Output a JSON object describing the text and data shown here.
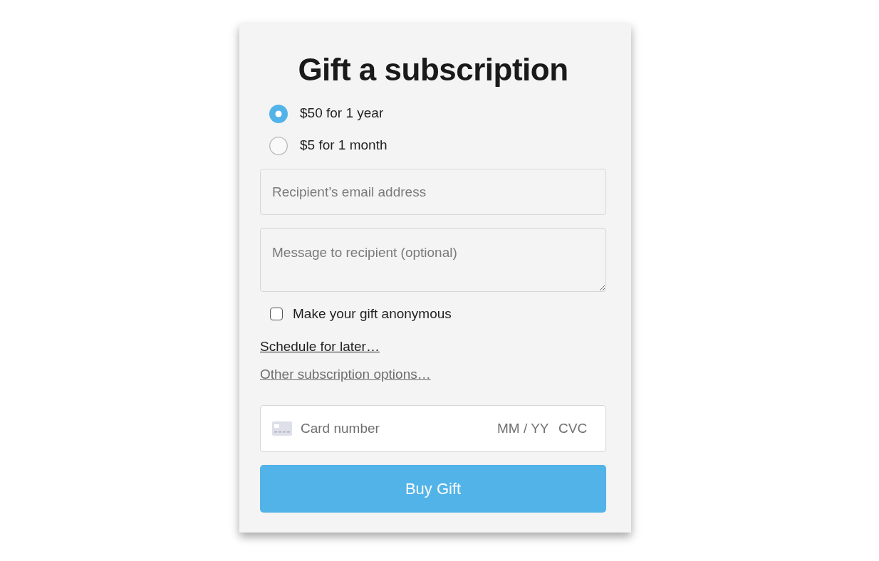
{
  "title": "Gift a subscription",
  "plans": [
    {
      "label": "$50 for 1 year",
      "selected": true
    },
    {
      "label": "$5 for 1 month",
      "selected": false
    }
  ],
  "email_field": {
    "placeholder": "Recipient’s email address"
  },
  "message_field": {
    "placeholder": "Message to recipient (optional)"
  },
  "anonymous": {
    "label": "Make your gift anonymous",
    "checked": false
  },
  "links": [
    {
      "label": "Schedule for later…",
      "kind": "primary"
    },
    {
      "label": "Other subscription options…",
      "kind": "secondary"
    }
  ],
  "card_field": {
    "number_placeholder": "Card number",
    "expiry_placeholder": "MM / YY",
    "cvc_placeholder": "CVC"
  },
  "submit_button": "Buy Gift"
}
